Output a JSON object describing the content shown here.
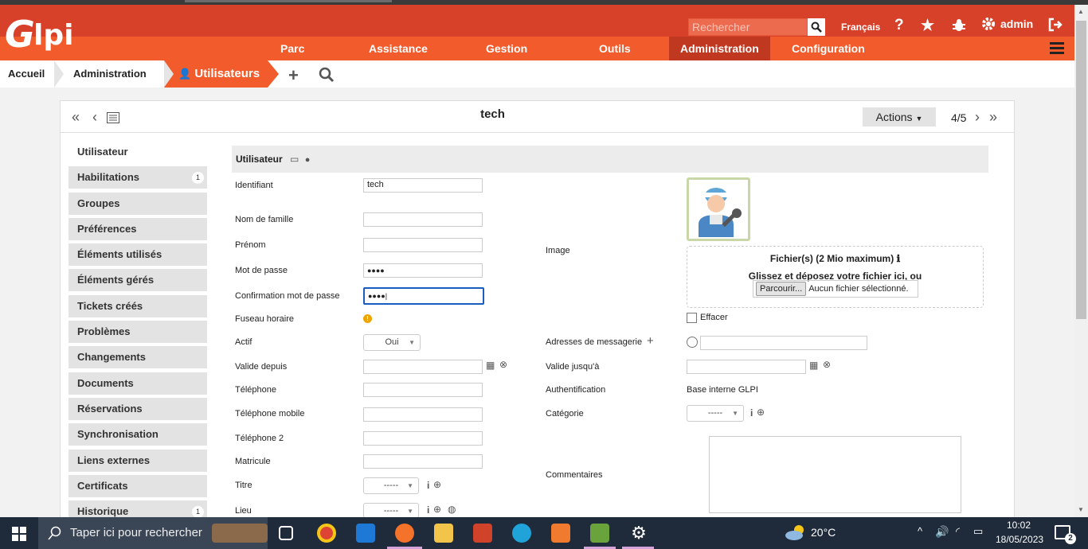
{
  "header": {
    "logo": "Glpi",
    "search_placeholder": "Rechercher",
    "language": "Français",
    "user": "admin",
    "menu": [
      "Parc",
      "Assistance",
      "Gestion",
      "Outils",
      "Administration",
      "Configuration"
    ]
  },
  "breadcrumb": [
    "Accueil",
    "Administration",
    "Utilisateurs"
  ],
  "record": {
    "title": "tech",
    "actions_label": "Actions",
    "pager": "4/5"
  },
  "tabs": [
    {
      "label": "Utilisateur",
      "badge": ""
    },
    {
      "label": "Habilitations",
      "badge": "1"
    },
    {
      "label": "Groupes",
      "badge": ""
    },
    {
      "label": "Préférences",
      "badge": ""
    },
    {
      "label": "Éléments utilisés",
      "badge": ""
    },
    {
      "label": "Éléments gérés",
      "badge": ""
    },
    {
      "label": "Tickets créés",
      "badge": ""
    },
    {
      "label": "Problèmes",
      "badge": ""
    },
    {
      "label": "Changements",
      "badge": ""
    },
    {
      "label": "Documents",
      "badge": ""
    },
    {
      "label": "Réservations",
      "badge": ""
    },
    {
      "label": "Synchronisation",
      "badge": ""
    },
    {
      "label": "Liens externes",
      "badge": ""
    },
    {
      "label": "Certificats",
      "badge": ""
    },
    {
      "label": "Historique",
      "badge": "1"
    }
  ],
  "form": {
    "section_title": "Utilisateur",
    "identifiant_label": "Identifiant",
    "identifiant_value": "tech",
    "nom_label": "Nom de famille",
    "prenom_label": "Prénom",
    "password_label": "Mot de passe",
    "password_value": "●●●●",
    "confirm_label": "Confirmation mot de passe",
    "confirm_value": "●●●●|",
    "timezone_label": "Fuseau horaire",
    "actif_label": "Actif",
    "actif_value": "Oui",
    "valid_from_label": "Valide depuis",
    "phone_label": "Téléphone",
    "mobile_label": "Téléphone mobile",
    "phone2_label": "Téléphone 2",
    "matricule_label": "Matricule",
    "titre_label": "Titre",
    "titre_value": "-----",
    "lieu_label": "Lieu",
    "lieu_value": "-----",
    "image_label": "Image",
    "dropzone_title": "Fichier(s) (2 Mio maximum)",
    "dropzone_text": "Glissez et déposez votre fichier ici, ou",
    "browse_label": "Parcourir...",
    "no_file": "Aucun fichier sélectionné.",
    "effacer_label": "Effacer",
    "email_label": "Adresses de messagerie",
    "valid_until_label": "Valide jusqu'à",
    "auth_label": "Authentification",
    "auth_value": "Base interne GLPI",
    "category_label": "Catégorie",
    "category_value": "-----",
    "comments_label": "Commentaires"
  },
  "taskbar": {
    "search_placeholder": "Taper ici pour rechercher",
    "weather": "20°C",
    "time": "10:02",
    "date": "18/05/2023",
    "notif_count": "2"
  }
}
